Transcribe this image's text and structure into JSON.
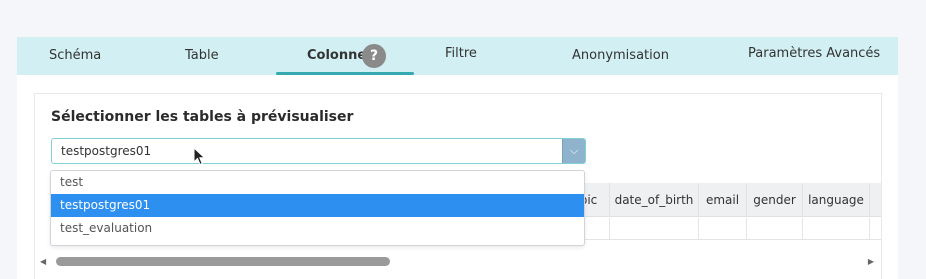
{
  "tabs": [
    {
      "label": "Schéma"
    },
    {
      "label": "Table"
    },
    {
      "label": "Colonne",
      "active": true
    },
    {
      "label": "Filtre"
    },
    {
      "label": "Anonymisation"
    },
    {
      "label": "Paramètres Avancés"
    }
  ],
  "help_label": "?",
  "card": {
    "title": "Sélectionner les tables à prévisualiser"
  },
  "select": {
    "value": "testpostgres01",
    "options": [
      "test",
      "testpostgres01",
      "test_evaluation"
    ],
    "selected_index": 1
  },
  "preview_table": {
    "columns": [
      "bic",
      "date_of_birth",
      "email",
      "gender",
      "language"
    ]
  },
  "colors": {
    "tabbar_bg": "#d2f0f3",
    "active_underline": "#35a9b0",
    "selected_option": "#2d8ff0"
  }
}
